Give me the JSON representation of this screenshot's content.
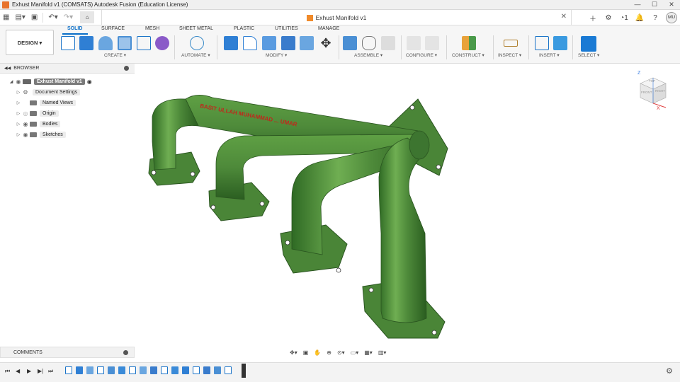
{
  "window": {
    "title": "Exhust Manifold v1 (COMSATS)   Autodesk Fusion (Education License)",
    "minimize": "—",
    "maximize": "☐",
    "close": "✕"
  },
  "document": {
    "tab_title": "Exhust Manifold v1",
    "user_initials": "MU",
    "notification_count": "1"
  },
  "workspace": {
    "label": "DESIGN ▾"
  },
  "ribbon": {
    "tabs": [
      "SOLID",
      "SURFACE",
      "MESH",
      "SHEET METAL",
      "PLASTIC",
      "UTILITIES",
      "MANAGE"
    ],
    "active_tab": "SOLID",
    "groups": [
      "CREATE ▾",
      "AUTOMATE ▾",
      "MODIFY ▾",
      "ASSEMBLE ▾",
      "CONFIGURE ▾",
      "CONSTRUCT ▾",
      "INSPECT ▾",
      "INSERT ▾",
      "SELECT ▾"
    ]
  },
  "browser": {
    "header": "BROWSER",
    "items": [
      {
        "label": "Exhust Manifold v1",
        "root": true
      },
      {
        "label": "Document Settings"
      },
      {
        "label": "Named Views"
      },
      {
        "label": "Origin"
      },
      {
        "label": "Bodies"
      },
      {
        "label": "Sketches"
      }
    ]
  },
  "comments": {
    "label": "COMMENTS"
  },
  "model": {
    "body_color": "#4e8a3a",
    "text_color": "#c0281c",
    "text": "BASIT ULLAH MUHAMMAD ... UMAR"
  },
  "viewcube": {
    "axis_x": "X",
    "axis_z": "Z",
    "face_top": "TOP",
    "face_front": "FRONT",
    "face_right": "RIGHT"
  },
  "colors": {
    "accent": "#0a6ec8",
    "brand": "#e8732c",
    "ribbon_bg": "#f6f6f6"
  }
}
